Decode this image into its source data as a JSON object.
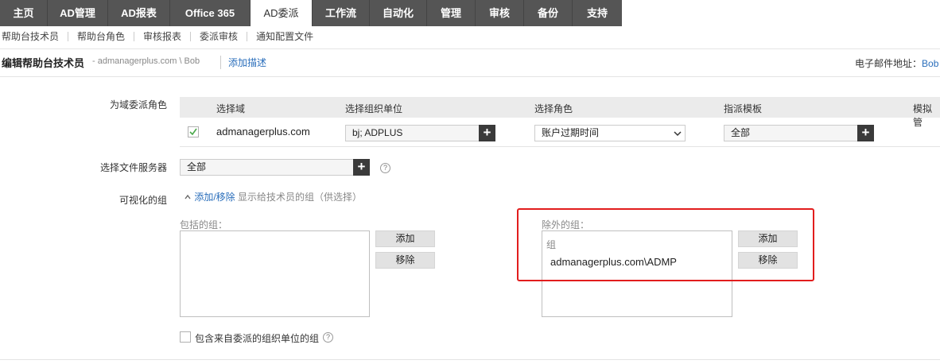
{
  "topnav": {
    "tabs": [
      {
        "label": "主页"
      },
      {
        "label": "AD管理"
      },
      {
        "label": "AD报表"
      },
      {
        "label": "Office 365"
      },
      {
        "label": "AD委派"
      },
      {
        "label": "工作流"
      },
      {
        "label": "自动化"
      },
      {
        "label": "管理"
      },
      {
        "label": "审核"
      },
      {
        "label": "备份"
      },
      {
        "label": "支持"
      }
    ],
    "active_index": 4
  },
  "subnav": {
    "items": [
      {
        "label": "帮助台技术员"
      },
      {
        "label": "帮助台角色"
      },
      {
        "label": "审核报表"
      },
      {
        "label": "委派审核"
      },
      {
        "label": "通知配置文件"
      }
    ]
  },
  "header": {
    "title": "编辑帮助台技术员",
    "subtitle": "- admanagerplus.com \\ Bob",
    "add_description": "添加描述",
    "email_label": "电子邮件地址：",
    "email_value": "Bob"
  },
  "delegation": {
    "label": "为域委派角色",
    "columns": [
      "选择域",
      "选择组织单位",
      "选择角色",
      "指派模板",
      "模拟管"
    ],
    "row": {
      "checked": true,
      "domain": "admanagerplus.com",
      "ou": "bj; ADPLUS",
      "role": "账户过期时间",
      "template": "全部"
    }
  },
  "file_server": {
    "label": "选择文件服务器",
    "value": "全部"
  },
  "visible_groups": {
    "label": "可视化的组",
    "toggle_icon": "chevron-up-icon",
    "link": "添加/移除",
    "hint": "显示给技术员的组（供选择）",
    "included": {
      "label": "包括的组：",
      "items": [],
      "add": "添加",
      "remove": "移除"
    },
    "excluded": {
      "label": "除外的组：",
      "column_header": "组",
      "items": [
        "admanagerplus.com\\ADMP"
      ],
      "add": "添加",
      "remove": "移除"
    },
    "include_delegated_ou": {
      "checked": false,
      "label": "包含来自委派的组织单位的组"
    }
  },
  "colors": {
    "nav_bg": "#555555",
    "link": "#2a6ebb",
    "highlight": "#e21d1d"
  }
}
